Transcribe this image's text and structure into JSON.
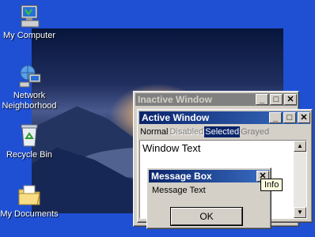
{
  "desktop_icons": [
    {
      "id": "my-computer",
      "label": "My Computer"
    },
    {
      "id": "network",
      "label": "Network Neighborhood"
    },
    {
      "id": "recycle",
      "label": "Recycle Bin"
    },
    {
      "id": "documents",
      "label": "My Documents"
    }
  ],
  "inactive_window": {
    "title": "Inactive Window"
  },
  "active_window": {
    "title": "Active Window",
    "menu": {
      "normal": "Normal",
      "disabled": "Disabled",
      "selected": "Selected",
      "grayed": "Grayed"
    },
    "content_text": "Window Text"
  },
  "message_box": {
    "title": "Message Box",
    "text": "Message Text",
    "ok_label": "OK",
    "tooltip": "Info"
  },
  "titlebar_buttons": {
    "minimize": "_",
    "maximize": "□",
    "close": "✕"
  },
  "colors": {
    "desktop": "#1f50d4",
    "active_title": "#0a246a",
    "inactive_title": "#808080"
  }
}
